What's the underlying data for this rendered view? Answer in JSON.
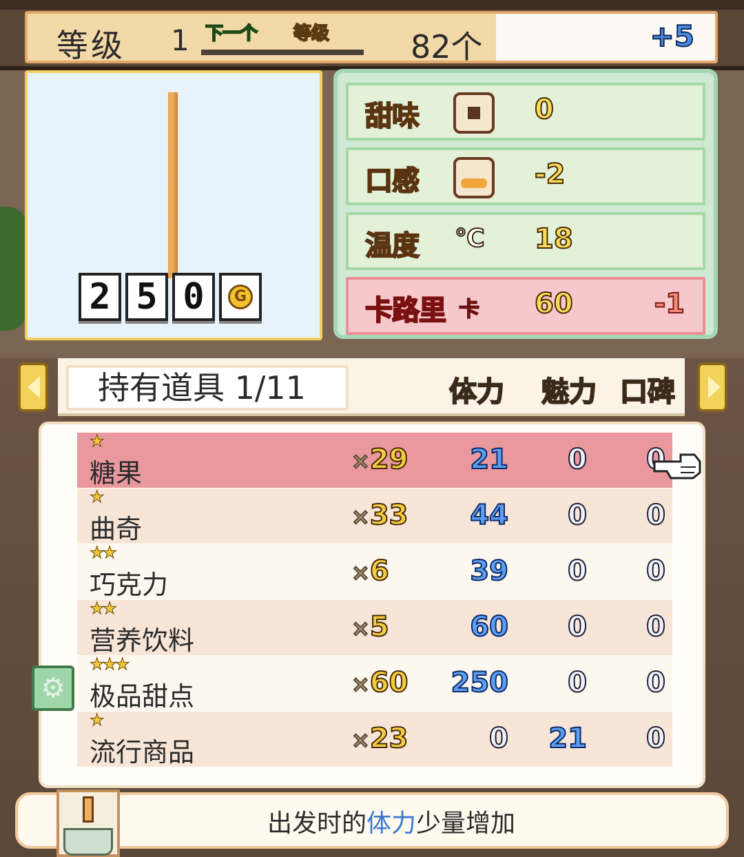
{
  "level": {
    "label": "等级",
    "value": "1",
    "next_tag": "下一个",
    "level_tag": "等级",
    "count": "82个",
    "bonus": "+5"
  },
  "preview": {
    "price_digits": [
      "2",
      "5",
      "0"
    ],
    "currency_symbol": "G"
  },
  "stats": {
    "sweet": {
      "label": "甜味",
      "value": "0"
    },
    "texture": {
      "label": "口感",
      "value": "-2"
    },
    "temperature": {
      "label": "温度",
      "unit": "℃",
      "value": "18"
    },
    "calorie": {
      "label": "卡路里",
      "unit": "卡",
      "value": "60",
      "delta": "-1"
    }
  },
  "items_header": {
    "tab_title": "持有道具 1/11",
    "columns": [
      "体力",
      "魅力",
      "口碑"
    ]
  },
  "items": [
    {
      "stars": "★",
      "name": "糖果",
      "qty": "29",
      "stamina": "21",
      "charm": "0",
      "reputation": "0",
      "selected": true
    },
    {
      "stars": "★",
      "name": "曲奇",
      "qty": "33",
      "stamina": "44",
      "charm": "0",
      "reputation": "0"
    },
    {
      "stars": "★★",
      "name": "巧克力",
      "qty": "6",
      "stamina": "39",
      "charm": "0",
      "reputation": "0"
    },
    {
      "stars": "★★",
      "name": "营养饮料",
      "qty": "5",
      "stamina": "60",
      "charm": "0",
      "reputation": "0"
    },
    {
      "stars": "★★★",
      "name": "极品甜点",
      "qty": "60",
      "stamina": "250",
      "charm": "0",
      "reputation": "0"
    },
    {
      "stars": "★",
      "name": "流行商品",
      "qty": "23",
      "stamina": "0",
      "charm": "21",
      "reputation": "0"
    }
  ],
  "qty_prefix": "×",
  "description": {
    "before": "出发时的",
    "highlight": "体力",
    "after": "少量增加"
  },
  "icons": {
    "sweet": "square-candy-icon",
    "texture": "bread-icon",
    "pointer": "pointing-hand-icon",
    "settings": "gear-icon",
    "coin": "gold-coin-icon"
  }
}
